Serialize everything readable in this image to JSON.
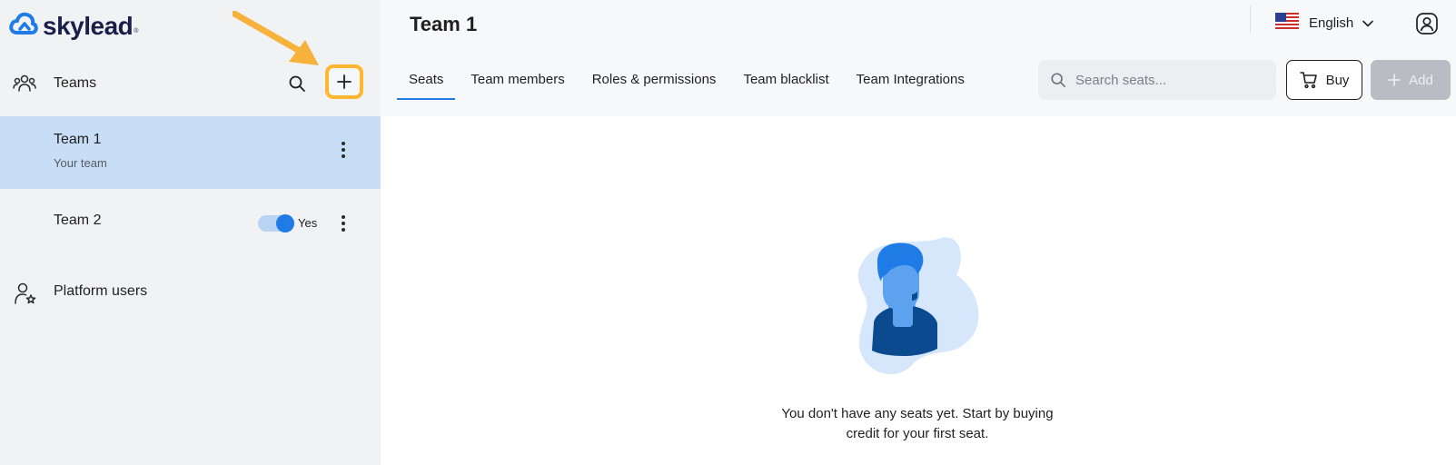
{
  "logo": {
    "text": "skylead",
    "mark": "®",
    "icon": "cloud-logo-icon",
    "color": "#1f7be6"
  },
  "sidebar": {
    "teams_label": "Teams",
    "teams": [
      {
        "name": "Team 1",
        "subtitle": "Your team",
        "selected": true
      },
      {
        "name": "Team 2",
        "toggle_label": "Yes",
        "toggle_on": true
      }
    ],
    "platform_users_label": "Platform users"
  },
  "header": {
    "title": "Team 1",
    "language": "English",
    "tabs": [
      {
        "label": "Seats",
        "active": true
      },
      {
        "label": "Team members"
      },
      {
        "label": "Roles & permissions"
      },
      {
        "label": "Team blacklist"
      },
      {
        "label": "Team Integrations"
      }
    ],
    "search_placeholder": "Search seats...",
    "buy_label": "Buy",
    "add_label": "Add"
  },
  "main": {
    "empty_line1": "You don't have any seats yet. Start by buying",
    "empty_line2": "credit for your first seat."
  },
  "colors": {
    "accent": "#1f7be6",
    "selected_bg": "#c7def6",
    "highlight": "#ffb62e",
    "sidebar_bg": "#f1f2f4"
  }
}
